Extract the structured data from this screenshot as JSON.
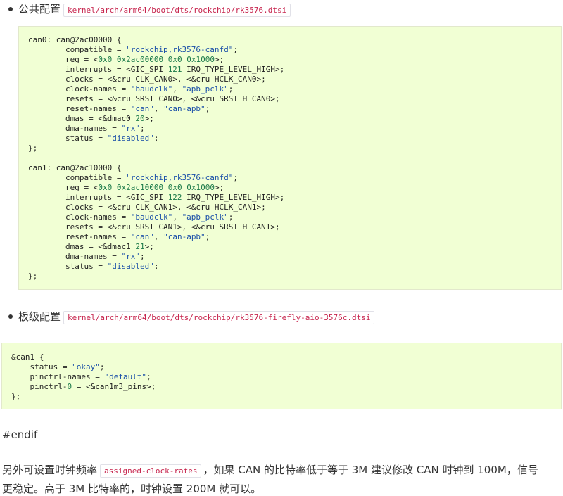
{
  "section1": {
    "label": "公共配置",
    "path": "kernel/arch/arm64/boot/dts/rockchip/rk3576.dtsi"
  },
  "code1": [
    "can0: can@2ac00000 {",
    "        compatible = \"rockchip,rk3576-canfd\";",
    "        reg = <0x0 0x2ac00000 0x0 0x1000>;",
    "        interrupts = <GIC_SPI 121 IRQ_TYPE_LEVEL_HIGH>;",
    "        clocks = <&cru CLK_CAN0>, <&cru HCLK_CAN0>;",
    "        clock-names = \"baudclk\", \"apb_pclk\";",
    "        resets = <&cru SRST_CAN0>, <&cru SRST_H_CAN0>;",
    "        reset-names = \"can\", \"can-apb\";",
    "        dmas = <&dmac0 20>;",
    "        dma-names = \"rx\";",
    "        status = \"disabled\";",
    "};",
    "",
    "can1: can@2ac10000 {",
    "        compatible = \"rockchip,rk3576-canfd\";",
    "        reg = <0x0 0x2ac10000 0x0 0x1000>;",
    "        interrupts = <GIC_SPI 122 IRQ_TYPE_LEVEL_HIGH>;",
    "        clocks = <&cru CLK_CAN1>, <&cru HCLK_CAN1>;",
    "        clock-names = \"baudclk\", \"apb_pclk\";",
    "        resets = <&cru SRST_CAN1>, <&cru SRST_H_CAN1>;",
    "        reset-names = \"can\", \"can-apb\";",
    "        dmas = <&dmac1 21>;",
    "        dma-names = \"rx\";",
    "        status = \"disabled\";",
    "};"
  ],
  "section2": {
    "label": "板级配置",
    "path": "kernel/arch/arm64/boot/dts/rockchip/rk3576-firefly-aio-3576c.dtsi"
  },
  "code2": [
    "&can1 {",
    "    status = \"okay\";",
    "    pinctrl-names = \"default\";",
    "    pinctrl-0 = <&can1m3_pins>;",
    "};"
  ],
  "endif_text": "#endif",
  "para": {
    "part1": "另外可设置时钟频率",
    "code": "assigned-clock-rates",
    "part2": "，如果 CAN 的比特率低于等于 3M 建议修改 CAN 时钟到 100M，信号",
    "line2": "更稳定。高于 3M 比特率的，时钟设置 200M 就可以。"
  },
  "colors": {
    "code_bg": "#f1ffd4",
    "string": "#1a4fa8",
    "number": "#1c7a4a",
    "inline_code": "#c7254e"
  }
}
